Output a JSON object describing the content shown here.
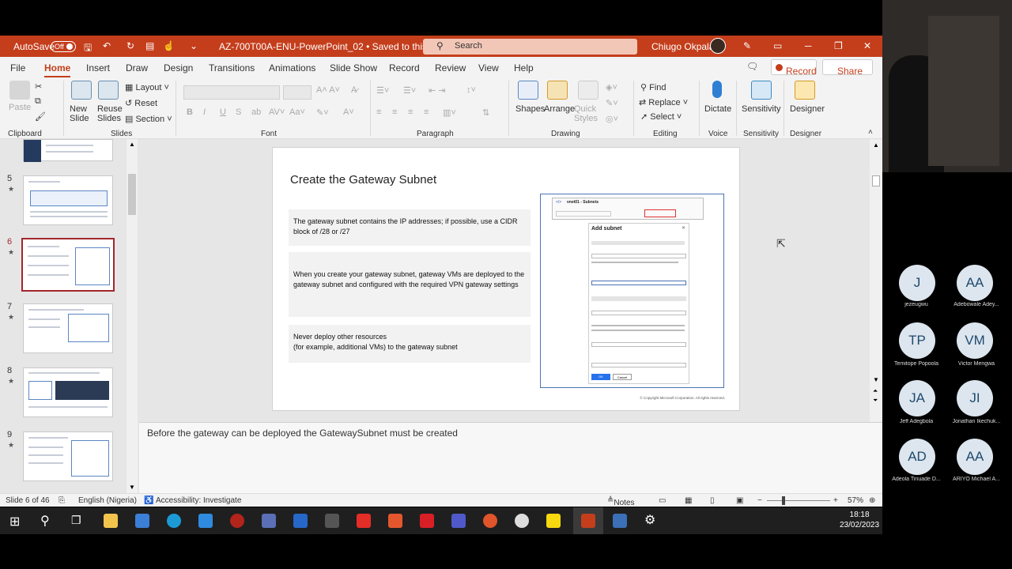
{
  "titlebar": {
    "autosave_label": "AutoSave",
    "autosave_state": "Off",
    "doc_title": "AZ-700T00A-ENU-PowerPoint_02 • Saved to this PC ˅",
    "search_placeholder": "Search",
    "user_name": "Chiugo Okpala"
  },
  "tabs": [
    "File",
    "Home",
    "Insert",
    "Draw",
    "Design",
    "Transitions",
    "Animations",
    "Slide Show",
    "Record",
    "Review",
    "View",
    "Help"
  ],
  "tab_buttons": {
    "record": "Record",
    "share": "Share"
  },
  "ribbon": {
    "clipboard": {
      "paste": "Paste",
      "label": "Clipboard"
    },
    "slides": {
      "new_slide": "New Slide",
      "reuse_slides": "Reuse Slides",
      "layout": "Layout",
      "reset": "Reset",
      "section": "Section",
      "label": "Slides"
    },
    "font": {
      "label": "Font"
    },
    "paragraph": {
      "label": "Paragraph"
    },
    "drawing": {
      "shapes": "Shapes",
      "arrange": "Arrange",
      "quick_styles": "Quick Styles",
      "label": "Drawing"
    },
    "editing": {
      "find": "Find",
      "replace": "Replace",
      "select": "Select",
      "label": "Editing"
    },
    "voice": {
      "dictate": "Dictate",
      "label": "Voice"
    },
    "sensitivity": {
      "button": "Sensitivity",
      "label": "Sensitivity"
    },
    "designer": {
      "button": "Designer",
      "label": "Designer"
    }
  },
  "thumbnails": [
    {
      "num": "5"
    },
    {
      "num": "6"
    },
    {
      "num": "7"
    },
    {
      "num": "8"
    },
    {
      "num": "9"
    }
  ],
  "slide": {
    "title": "Create the Gateway Subnet",
    "boxes": [
      "The gateway subnet contains the IP addresses; if possible, use a CIDR block of /28 or /27",
      "When you create your gateway subnet, gateway VMs are deployed to the gateway subnet and configured with the required VPN gateway settings",
      "Never deploy other resources\n(for example, additional VMs) to the gateway subnet"
    ],
    "screenshot": {
      "header": "vnet01 - Subnets",
      "panel_title": "Add subnet",
      "ok": "OK",
      "cancel": "Cancel"
    },
    "copyright": "© Copyright Microsoft Corporation. All rights reserved."
  },
  "notes": "Before the gateway can be deployed the GatewaySubnet must be created",
  "status": {
    "slide_info": "Slide 6 of 46",
    "language": "English (Nigeria)",
    "accessibility": "Accessibility: Investigate",
    "notes": "Notes",
    "zoom": "57%"
  },
  "clock": {
    "time": "18:18",
    "date": "23/02/2023"
  },
  "participants": [
    {
      "initials": "J",
      "name": "jezeugwu"
    },
    {
      "initials": "AA",
      "name": "Adebowale Adey..."
    },
    {
      "initials": "TP",
      "name": "Temitope Popoola"
    },
    {
      "initials": "VM",
      "name": "Victor Mengwa"
    },
    {
      "initials": "JA",
      "name": "Jeff Adegbola"
    },
    {
      "initials": "JI",
      "name": "Jonathan Ikechuk..."
    },
    {
      "initials": "AD",
      "name": "Adeola Tinuade D..."
    },
    {
      "initials": "AA",
      "name": "ARIYO Michael A..."
    }
  ]
}
